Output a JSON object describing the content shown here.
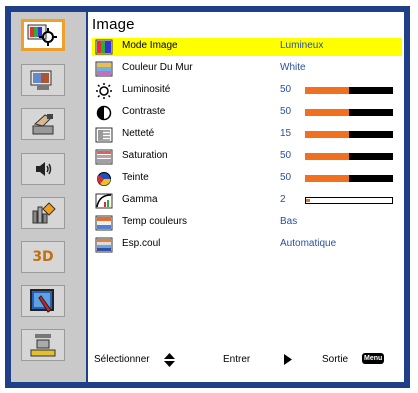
{
  "menu": {
    "title": "Image",
    "items": [
      {
        "label": "Mode Image",
        "value": "Lumineux",
        "selected": true,
        "icon": "mode-image-icon"
      },
      {
        "label": "Couleur Du Mur",
        "value": "White",
        "icon": "wall-color-icon"
      },
      {
        "label": "Luminosité",
        "value": "50",
        "level": 50,
        "icon": "brightness-sun-icon"
      },
      {
        "label": "Contraste",
        "value": "50",
        "level": 50,
        "icon": "contrast-icon"
      },
      {
        "label": "Netteté",
        "value": "15",
        "level": 50,
        "icon": "sharpness-icon"
      },
      {
        "label": "Saturation",
        "value": "50",
        "level": 50,
        "icon": "saturation-icon"
      },
      {
        "label": "Teinte",
        "value": "50",
        "level": 50,
        "icon": "tint-icon"
      },
      {
        "label": "Gamma",
        "value": "2",
        "level": 5,
        "icon": "gamma-icon"
      },
      {
        "label": "Temp couleurs",
        "value": "Bas",
        "icon": "color-temp-icon"
      },
      {
        "label": "Esp.coul",
        "value": "Automatique",
        "icon": "color-space-icon"
      }
    ]
  },
  "sidebar": {
    "items": [
      {
        "name": "image-settings",
        "icon": "image-settings-icon",
        "active": true
      },
      {
        "name": "display",
        "icon": "display-icon"
      },
      {
        "name": "setup",
        "icon": "setup-hand-icon"
      },
      {
        "name": "audio",
        "icon": "speaker-icon"
      },
      {
        "name": "options",
        "icon": "options-icon"
      },
      {
        "name": "3d",
        "label": "3D",
        "icon": "3d-icon"
      },
      {
        "name": "interactive",
        "icon": "interactive-pen-icon"
      },
      {
        "name": "lan",
        "icon": "network-icon"
      }
    ]
  },
  "footer": {
    "select_label": "Sélectionner",
    "enter_label": "Entrer",
    "exit_label": "Sortie",
    "menu_key": "Menu"
  },
  "colors": {
    "frame": "#1f3f88",
    "highlight": "#ffff00",
    "bar_fill": "#f07020",
    "value_text": "#2a4fa0"
  }
}
